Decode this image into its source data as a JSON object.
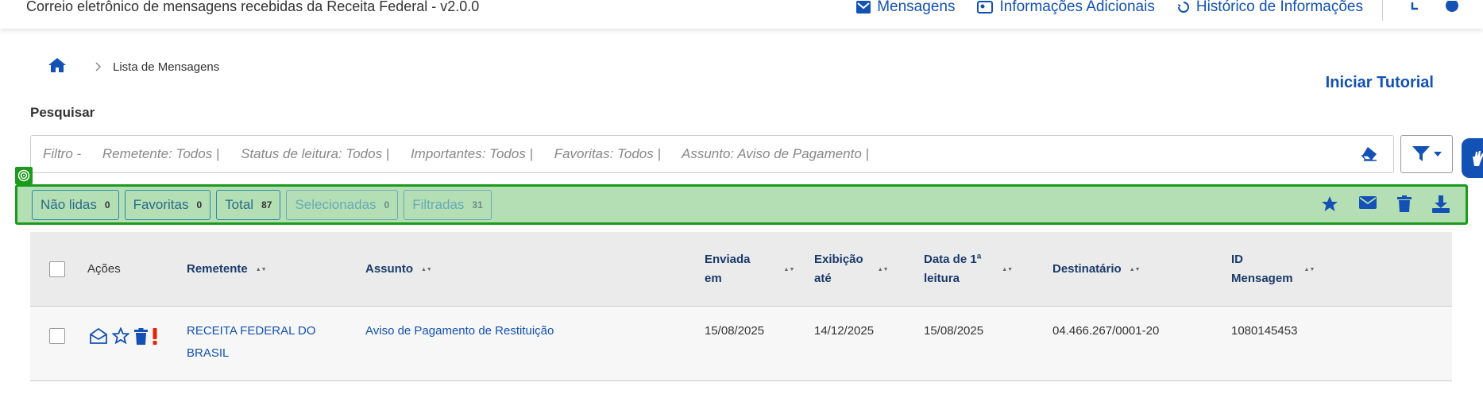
{
  "header": {
    "title": "Correio eletrônico de mensagens recebidas da Receita Federal - v2.0.0",
    "nav": [
      {
        "label": "Mensagens",
        "icon": "envelope-icon"
      },
      {
        "label": "Informações Adicionais",
        "icon": "id-card-icon"
      },
      {
        "label": "Histórico de Informações",
        "icon": "history-icon"
      }
    ]
  },
  "breadcrumb": {
    "home_icon": "home-icon",
    "current": "Lista de Mensagens"
  },
  "tutorial_label": "Iniciar Tutorial",
  "search": {
    "label": "Pesquisar",
    "filters": [
      "Filtro -",
      "Remetente: Todos |",
      "Status de leitura: Todos |",
      "Importantes: Todos |",
      "Favoritas: Todos |",
      "Assunto: Aviso de Pagamento |"
    ]
  },
  "stats": [
    {
      "label": "Não lidas",
      "count": "0"
    },
    {
      "label": "Favoritas",
      "count": "0"
    },
    {
      "label": "Total",
      "count": "87"
    },
    {
      "label": "Selecionadas",
      "count": "0"
    },
    {
      "label": "Filtradas",
      "count": "31"
    }
  ],
  "table": {
    "headers": {
      "acoes": "Ações",
      "remetente": "Remetente",
      "assunto": "Assunto",
      "enviada_1": "Enviada",
      "enviada_2": "em",
      "exibicao_1": "Exibição",
      "exibicao_2": "até",
      "leitura_1": "Data de 1ª",
      "leitura_2": "leitura",
      "destinatario": "Destinatário",
      "id_1": "ID",
      "id_2": "Mensagem"
    },
    "rows": [
      {
        "remetente_1": "RECEITA FEDERAL DO",
        "remetente_2": "BRASIL",
        "assunto": "Aviso de Pagamento de Restituição",
        "enviada": "15/08/2025",
        "exibicao": "14/12/2025",
        "leitura": "15/08/2025",
        "destinatario": "04.466.267/0001-20",
        "id": "1080145453"
      }
    ]
  },
  "colors": {
    "primary": "#1351b4",
    "highlight_bg": "#b4dfb4",
    "highlight_border": "#1c9a1c",
    "important": "#e52207"
  }
}
